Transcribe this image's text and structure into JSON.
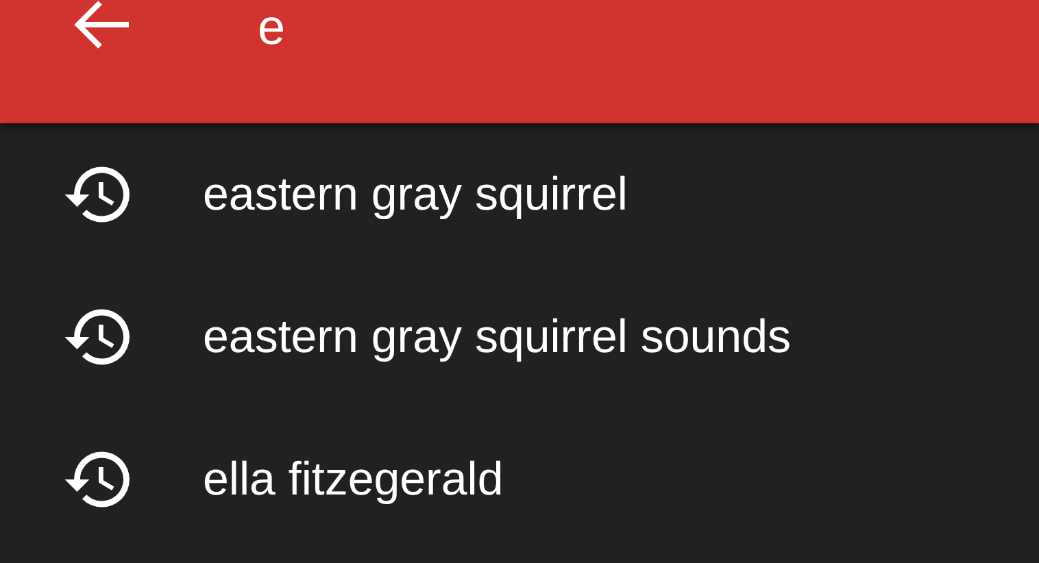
{
  "search": {
    "value": "e"
  },
  "suggestions": [
    {
      "text": "eastern gray squirrel"
    },
    {
      "text": "eastern gray squirrel sounds"
    },
    {
      "text": "ella fitzegerald"
    }
  ]
}
